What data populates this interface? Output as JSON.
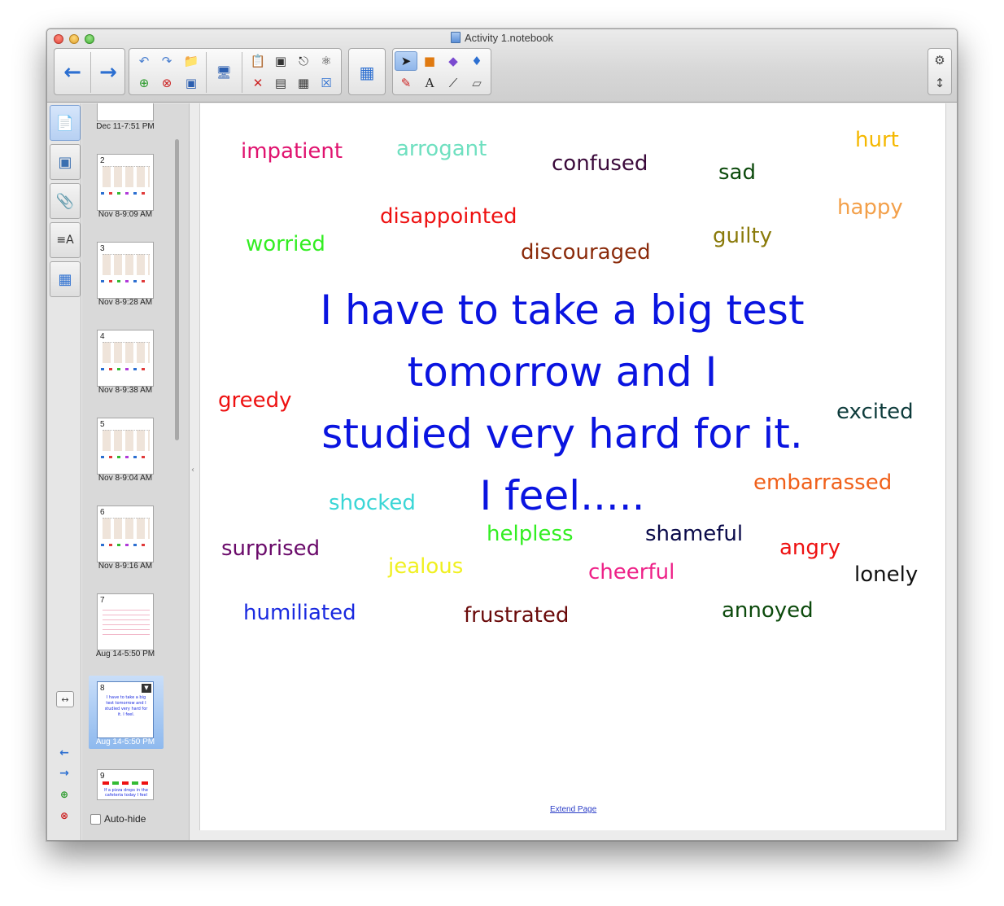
{
  "window": {
    "title": "Activity 1.notebook"
  },
  "toolbar": {
    "back_icon": "arrow-left-icon",
    "forward_icon": "arrow-right-icon",
    "accent": "#2c6fd1"
  },
  "sidebar": {
    "tabs": [
      "page-sorter",
      "gallery",
      "attachments",
      "properties",
      "add-ons"
    ],
    "pages": [
      {
        "number": "",
        "label": "Dec 11-7:51 PM"
      },
      {
        "number": "2",
        "label": "Nov 8-9:09 AM"
      },
      {
        "number": "3",
        "label": "Nov 8-9:28 AM"
      },
      {
        "number": "4",
        "label": "Nov 8-9:38 AM"
      },
      {
        "number": "5",
        "label": "Nov 8-9:04 AM"
      },
      {
        "number": "6",
        "label": "Nov 8-9:16 AM"
      },
      {
        "number": "7",
        "label": "Aug 14-5:50 PM"
      },
      {
        "number": "8",
        "label": "Aug 14-5:50 PM"
      },
      {
        "number": "9",
        "label": ""
      }
    ],
    "thumb8_text": "I have to take a big test tomorrow and I studied very hard for it. I feel.",
    "thumb9_text": "If a pizza drops in the cafeteria today I feel",
    "autohide_label": "Auto-hide"
  },
  "canvas": {
    "prompt_lines": [
      "I have to take a big test",
      "tomorrow and I",
      "studied very hard for it.",
      "I feel....."
    ],
    "prompt_color": "#0a14e0",
    "words": [
      {
        "text": "impatient",
        "color": "#e0136f"
      },
      {
        "text": "arrogant",
        "color": "#6fe0c0"
      },
      {
        "text": "confused",
        "color": "#3b0a3b"
      },
      {
        "text": "sad",
        "color": "#0c4a0c"
      },
      {
        "text": "hurt",
        "color": "#f5b800"
      },
      {
        "text": "disappointed",
        "color": "#ee1111"
      },
      {
        "text": "happy",
        "color": "#f3a04a"
      },
      {
        "text": "worried",
        "color": "#33ee22"
      },
      {
        "text": "discouraged",
        "color": "#8a2a0a"
      },
      {
        "text": "guilty",
        "color": "#8a7a0a"
      },
      {
        "text": "greedy",
        "color": "#ee1111"
      },
      {
        "text": "excited",
        "color": "#0d3b3b"
      },
      {
        "text": "embarrassed",
        "color": "#f0601a"
      },
      {
        "text": "shocked",
        "color": "#3ad6d6"
      },
      {
        "text": "helpless",
        "color": "#33ee22"
      },
      {
        "text": "shameful",
        "color": "#0a0a4a"
      },
      {
        "text": "surprised",
        "color": "#6a0a6a"
      },
      {
        "text": "jealous",
        "color": "#f0f020"
      },
      {
        "text": "angry",
        "color": "#ee1111"
      },
      {
        "text": "cheerful",
        "color": "#ee2288"
      },
      {
        "text": "lonely",
        "color": "#111111"
      },
      {
        "text": "humiliated",
        "color": "#1a2ae0"
      },
      {
        "text": "frustrated",
        "color": "#6a0a0a"
      },
      {
        "text": "annoyed",
        "color": "#0c4a0c"
      }
    ],
    "extend_link": "Extend Page"
  }
}
